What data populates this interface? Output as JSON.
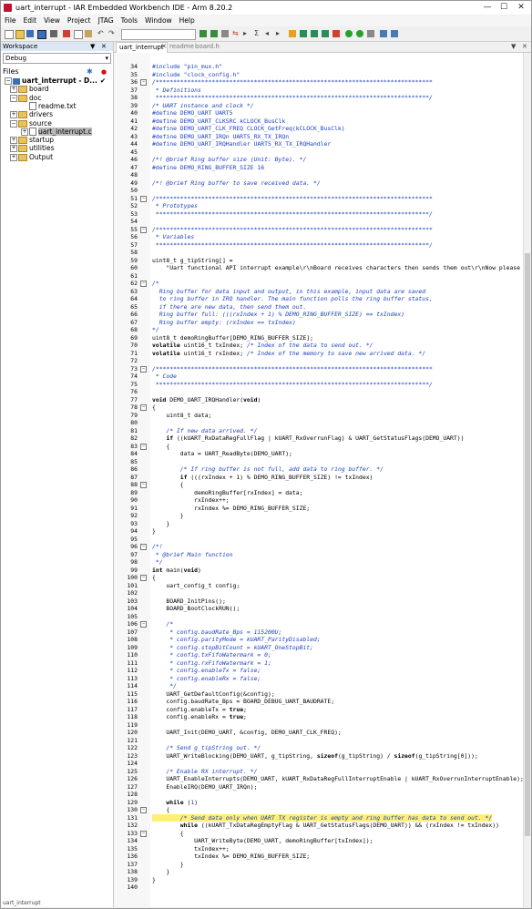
{
  "window": {
    "title": "uart_interrupt - IAR Embedded Workbench IDE - Arm 8.20.2",
    "minimize": "—",
    "maximize": "☐",
    "close": "✕"
  },
  "menu": [
    "File",
    "Edit",
    "View",
    "Project",
    "JTAG",
    "Tools",
    "Window",
    "Help"
  ],
  "workspace": {
    "header": "Workspace",
    "config": "Debug",
    "files_label": "Files",
    "pin": "▼",
    "close": "✕",
    "tree": [
      {
        "label": "uart_interrupt - D...",
        "kind": "project",
        "expander": "−",
        "check": "✔"
      },
      {
        "label": "board",
        "kind": "folder",
        "expander": "+"
      },
      {
        "label": "doc",
        "kind": "folder",
        "expander": "−"
      },
      {
        "label": "readme.txt",
        "kind": "file",
        "expander": ""
      },
      {
        "label": "drivers",
        "kind": "folder",
        "expander": "+"
      },
      {
        "label": "source",
        "kind": "folder",
        "expander": "−"
      },
      {
        "label": "uart_interrupt.c",
        "kind": "file",
        "expander": "+",
        "selected": true
      },
      {
        "label": "startup",
        "kind": "folder",
        "expander": "+"
      },
      {
        "label": "utilities",
        "kind": "folder",
        "expander": "+"
      },
      {
        "label": "Output",
        "kind": "folder",
        "expander": "+"
      }
    ]
  },
  "tabs": [
    {
      "label": "uart_interrupt",
      "active": true
    },
    {
      "label": "readme",
      "active": false
    },
    {
      "label": "board.h",
      "active": false
    }
  ],
  "tab_controls": [
    "▼",
    "✕"
  ],
  "bottom_tab": "uart_interrupt",
  "code_lines": [
    {
      "n": "34",
      "t": "#include \"pin_mux.h\"",
      "c": "pp"
    },
    {
      "n": "35",
      "t": "#include \"clock_config.h\"",
      "c": "pp"
    },
    {
      "n": "36",
      "t": "/*******************************************************************************",
      "c": "com",
      "f": "−"
    },
    {
      "n": "37",
      "t": " * Definitions",
      "c": "com"
    },
    {
      "n": "38",
      "t": " ******************************************************************************/",
      "c": "com"
    },
    {
      "n": "39",
      "t": "/* UART instance and clock */",
      "c": "com"
    },
    {
      "n": "40",
      "t": "#define DEMO_UART UART5",
      "c": "pp"
    },
    {
      "n": "41",
      "t": "#define DEMO_UART_CLKSRC kCLOCK_BusClk",
      "c": "pp"
    },
    {
      "n": "42",
      "t": "#define DEMO_UART_CLK_FREQ CLOCK_GetFreq(kCLOCK_BusClk)",
      "c": "pp"
    },
    {
      "n": "43",
      "t": "#define DEMO_UART_IRQn UART5_RX_TX_IRQn",
      "c": "pp"
    },
    {
      "n": "44",
      "t": "#define DEMO_UART_IRQHandler UART5_RX_TX_IRQHandler",
      "c": "pp"
    },
    {
      "n": "45",
      "t": "",
      "c": ""
    },
    {
      "n": "46",
      "t": "/*! @brief Ring buffer size (Unit: Byte). */",
      "c": "com"
    },
    {
      "n": "47",
      "t": "#define DEMO_RING_BUFFER_SIZE 16",
      "c": "pp"
    },
    {
      "n": "48",
      "t": "",
      "c": ""
    },
    {
      "n": "49",
      "t": "/*! @brief Ring buffer to save received data. */",
      "c": "com"
    },
    {
      "n": "50",
      "t": "",
      "c": ""
    },
    {
      "n": "51",
      "t": "/*******************************************************************************",
      "c": "com",
      "f": "−"
    },
    {
      "n": "52",
      "t": " * Prototypes",
      "c": "com"
    },
    {
      "n": "53",
      "t": " ******************************************************************************/",
      "c": "com"
    },
    {
      "n": "54",
      "t": "",
      "c": ""
    },
    {
      "n": "55",
      "t": "/*******************************************************************************",
      "c": "com",
      "f": "−"
    },
    {
      "n": "56",
      "t": " * Variables",
      "c": "com"
    },
    {
      "n": "57",
      "t": " ******************************************************************************/",
      "c": "com"
    },
    {
      "n": "58",
      "t": "",
      "c": ""
    },
    {
      "n": "59",
      "t": "uint8_t g_tipString[] =",
      "c": ""
    },
    {
      "n": "60",
      "t": "    \"Uart functional API interrupt example\\r\\nBoard receives characters then sends them out\\r\\nNow please i",
      "c": ""
    },
    {
      "n": "61",
      "t": "",
      "c": ""
    },
    {
      "n": "62",
      "t": "/*",
      "c": "com",
      "f": "−"
    },
    {
      "n": "63",
      "t": "  Ring buffer for data input and output, in this example, input data are saved",
      "c": "com"
    },
    {
      "n": "64",
      "t": "  to ring buffer in IRQ handler. The main function polls the ring buffer status,",
      "c": "com"
    },
    {
      "n": "65",
      "t": "  if there are new data, then send them out.",
      "c": "com"
    },
    {
      "n": "66",
      "t": "  Ring buffer full: (((rxIndex + 1) % DEMO_RING_BUFFER_SIZE) == txIndex)",
      "c": "com"
    },
    {
      "n": "67",
      "t": "  Ring buffer empty: (rxIndex == txIndex)",
      "c": "com"
    },
    {
      "n": "68",
      "t": "*/",
      "c": "com"
    },
    {
      "n": "69",
      "t": "uint8_t demoRingBuffer[DEMO_RING_BUFFER_SIZE];",
      "c": ""
    },
    {
      "n": "70",
      "t": "volatile uint16_t txIndex; /* Index of the data to send out. */",
      "c": "mixkw"
    },
    {
      "n": "71",
      "t": "volatile uint16_t rxIndex; /* Index of the memory to save new arrived data. */",
      "c": "mixkw"
    },
    {
      "n": "72",
      "t": "",
      "c": ""
    },
    {
      "n": "73",
      "t": "/*******************************************************************************",
      "c": "com",
      "f": "−"
    },
    {
      "n": "74",
      "t": " * Code",
      "c": "com"
    },
    {
      "n": "75",
      "t": " ******************************************************************************/",
      "c": "com"
    },
    {
      "n": "76",
      "t": "",
      "c": ""
    },
    {
      "n": "77",
      "t": "void DEMO_UART_IRQHandler(void)",
      "c": ""
    },
    {
      "n": "78",
      "t": "{",
      "c": "",
      "f": "−"
    },
    {
      "n": "79",
      "t": "    uint8_t data;",
      "c": ""
    },
    {
      "n": "80",
      "t": "",
      "c": ""
    },
    {
      "n": "81",
      "t": "    /* If new data arrived. */",
      "c": "com"
    },
    {
      "n": "82",
      "t": "    if ((kUART_RxDataRegFullFlag | kUART_RxOverrunFlag) & UART_GetStatusFlags(DEMO_UART))",
      "c": ""
    },
    {
      "n": "83",
      "t": "    {",
      "c": "",
      "f": "−"
    },
    {
      "n": "84",
      "t": "        data = UART_ReadByte(DEMO_UART);",
      "c": ""
    },
    {
      "n": "85",
      "t": "",
      "c": ""
    },
    {
      "n": "86",
      "t": "        /* If ring buffer is not full, add data to ring buffer. */",
      "c": "com"
    },
    {
      "n": "87",
      "t": "        if (((rxIndex + 1) % DEMO_RING_BUFFER_SIZE) != txIndex)",
      "c": ""
    },
    {
      "n": "88",
      "t": "        {",
      "c": "",
      "f": "−"
    },
    {
      "n": "89",
      "t": "            demoRingBuffer[rxIndex] = data;",
      "c": ""
    },
    {
      "n": "90",
      "t": "            rxIndex++;",
      "c": ""
    },
    {
      "n": "91",
      "t": "            rxIndex %= DEMO_RING_BUFFER_SIZE;",
      "c": ""
    },
    {
      "n": "92",
      "t": "        }",
      "c": ""
    },
    {
      "n": "93",
      "t": "    }",
      "c": ""
    },
    {
      "n": "94",
      "t": "}",
      "c": ""
    },
    {
      "n": "95",
      "t": "",
      "c": ""
    },
    {
      "n": "96",
      "t": "/*!",
      "c": "com",
      "f": "−"
    },
    {
      "n": "97",
      "t": " * @brief Main function",
      "c": "com"
    },
    {
      "n": "98",
      "t": " */",
      "c": "com"
    },
    {
      "n": "99",
      "t": "int main(void)",
      "c": ""
    },
    {
      "n": "100",
      "t": "{",
      "c": "",
      "f": "−"
    },
    {
      "n": "101",
      "t": "    uart_config_t config;",
      "c": ""
    },
    {
      "n": "102",
      "t": "",
      "c": ""
    },
    {
      "n": "103",
      "t": "    BOARD_InitPins();",
      "c": ""
    },
    {
      "n": "104",
      "t": "    BOARD_BootClockRUN();",
      "c": ""
    },
    {
      "n": "105",
      "t": "",
      "c": ""
    },
    {
      "n": "106",
      "t": "    /*",
      "c": "com",
      "f": "−"
    },
    {
      "n": "107",
      "t": "     * config.baudRate_Bps = 115200U;",
      "c": "com"
    },
    {
      "n": "108",
      "t": "     * config.parityMode = kUART_ParityDisabled;",
      "c": "com"
    },
    {
      "n": "109",
      "t": "     * config.stopBitCount = kUART_OneStopBit;",
      "c": "com"
    },
    {
      "n": "110",
      "t": "     * config.txFifoWatermark = 0;",
      "c": "com"
    },
    {
      "n": "111",
      "t": "     * config.rxFifoWatermark = 1;",
      "c": "com"
    },
    {
      "n": "112",
      "t": "     * config.enableTx = false;",
      "c": "com"
    },
    {
      "n": "113",
      "t": "     * config.enableRx = false;",
      "c": "com"
    },
    {
      "n": "114",
      "t": "     */",
      "c": "com"
    },
    {
      "n": "115",
      "t": "    UART_GetDefaultConfig(&config);",
      "c": ""
    },
    {
      "n": "116",
      "t": "    config.baudRate_Bps = BOARD_DEBUG_UART_BAUDRATE;",
      "c": ""
    },
    {
      "n": "117",
      "t": "    config.enableTx = true;",
      "c": ""
    },
    {
      "n": "118",
      "t": "    config.enableRx = true;",
      "c": ""
    },
    {
      "n": "119",
      "t": "",
      "c": ""
    },
    {
      "n": "120",
      "t": "    UART_Init(DEMO_UART, &config, DEMO_UART_CLK_FREQ);",
      "c": ""
    },
    {
      "n": "121",
      "t": "",
      "c": ""
    },
    {
      "n": "122",
      "t": "    /* Send g_tipString out. */",
      "c": "com"
    },
    {
      "n": "123",
      "t": "    UART_WriteBlocking(DEMO_UART, g_tipString, sizeof(g_tipString) / sizeof(g_tipString[0]));",
      "c": ""
    },
    {
      "n": "124",
      "t": "",
      "c": ""
    },
    {
      "n": "125",
      "t": "    /* Enable RX interrupt. */",
      "c": "com"
    },
    {
      "n": "126",
      "t": "    UART_EnableInterrupts(DEMO_UART, kUART_RxDataRegFullInterruptEnable | kUART_RxOverrunInterruptEnable);",
      "c": ""
    },
    {
      "n": "127",
      "t": "    EnableIRQ(DEMO_UART_IRQn);",
      "c": ""
    },
    {
      "n": "128",
      "t": "",
      "c": ""
    },
    {
      "n": "129",
      "t": "    while (1)",
      "c": ""
    },
    {
      "n": "130",
      "t": "    {",
      "c": "",
      "f": "−"
    },
    {
      "n": "131",
      "t": "        /* Send data only when UART TX register is empty and ring buffer has data to send out. */",
      "c": "com",
      "hl": true
    },
    {
      "n": "132",
      "t": "        while ((kUART_TxDataRegEmptyFlag & UART_GetStatusFlags(DEMO_UART)) && (rxIndex != txIndex))",
      "c": ""
    },
    {
      "n": "133",
      "t": "        {",
      "c": "",
      "f": "−"
    },
    {
      "n": "134",
      "t": "            UART_WriteByte(DEMO_UART, demoRingBuffer[txIndex]);",
      "c": ""
    },
    {
      "n": "135",
      "t": "            txIndex++;",
      "c": ""
    },
    {
      "n": "136",
      "t": "            txIndex %= DEMO_RING_BUFFER_SIZE;",
      "c": ""
    },
    {
      "n": "137",
      "t": "        }",
      "c": ""
    },
    {
      "n": "138",
      "t": "    }",
      "c": ""
    },
    {
      "n": "139",
      "t": "}",
      "c": ""
    },
    {
      "n": "140",
      "t": "",
      "c": ""
    }
  ]
}
